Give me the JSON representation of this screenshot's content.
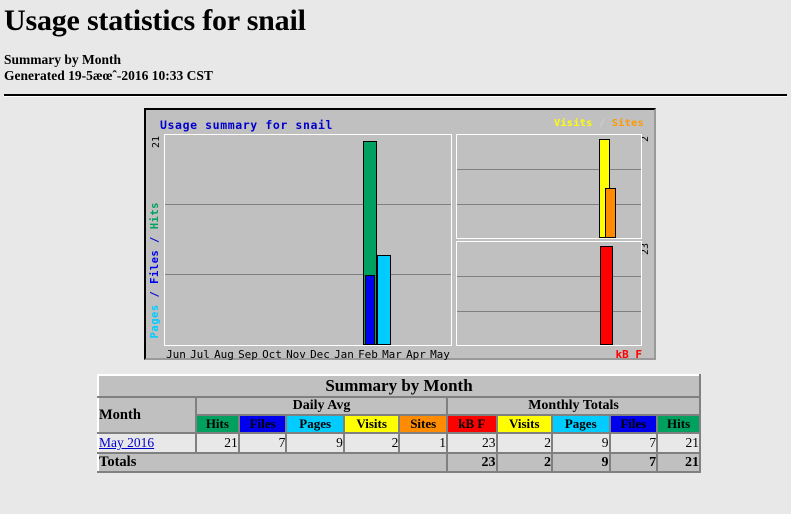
{
  "header": {
    "title": "Usage statistics for snail",
    "summary_line": "Summary by Month",
    "generated_line": "Generated 19-5æœˆ-2016 10:33 CST"
  },
  "chart": {
    "title": "Usage summary for snail",
    "legend_visits": "Visits",
    "legend_separator": " / ",
    "legend_sites": "Sites",
    "left_axis_max": "21",
    "left_axis_label_pages": "Pages",
    "left_axis_label_sep1": " / ",
    "left_axis_label_files": "Files",
    "left_axis_label_sep2": " / ",
    "left_axis_label_hits": "Hits",
    "right_axis_visits_max": "2",
    "right_axis_kb_max": "23",
    "kb_footer": "kB F"
  },
  "chart_data": {
    "type": "bar",
    "title": "Usage summary for snail",
    "categories": [
      "Jun",
      "Jul",
      "Aug",
      "Sep",
      "Oct",
      "Nov",
      "Dec",
      "Jan",
      "Feb",
      "Mar",
      "Apr",
      "May"
    ],
    "panels": [
      {
        "name": "hits-files-pages",
        "ylabel": "Pages / Files / Hits",
        "ylim": [
          0,
          21
        ],
        "grid": true,
        "series": [
          {
            "name": "Hits",
            "color": "#00A060",
            "values": [
              0,
              0,
              0,
              0,
              0,
              0,
              0,
              0,
              0,
              0,
              0,
              21
            ]
          },
          {
            "name": "Files",
            "color": "#0000EE",
            "values": [
              0,
              0,
              0,
              0,
              0,
              0,
              0,
              0,
              0,
              0,
              0,
              7
            ]
          },
          {
            "name": "Pages",
            "color": "#00CCFF",
            "values": [
              0,
              0,
              0,
              0,
              0,
              0,
              0,
              0,
              0,
              0,
              0,
              9
            ]
          }
        ]
      },
      {
        "name": "visits-sites",
        "ylabel": "Visits / Sites",
        "ylim": [
          0,
          2
        ],
        "grid": true,
        "series": [
          {
            "name": "Visits",
            "color": "#FFFF00",
            "values": [
              2
            ]
          },
          {
            "name": "Sites",
            "color": "#FF8C00",
            "values": [
              1
            ]
          }
        ]
      },
      {
        "name": "kbytes",
        "ylabel": "kB F",
        "ylim": [
          0,
          23
        ],
        "grid": true,
        "series": [
          {
            "name": "kB F",
            "color": "#FF0000",
            "values": [
              23
            ]
          }
        ]
      }
    ]
  },
  "table": {
    "caption": "Summary by Month",
    "group_headers": [
      "Daily Avg",
      "Monthly Totals"
    ],
    "month_header": "Month",
    "columns": [
      {
        "label": "Hits",
        "color": "#00A060"
      },
      {
        "label": "Files",
        "color": "#0000EE"
      },
      {
        "label": "Pages",
        "color": "#00CCFF"
      },
      {
        "label": "Visits",
        "color": "#FFFF00"
      },
      {
        "label": "Sites",
        "color": "#FF8C00"
      },
      {
        "label": "kB F",
        "color": "#FF0000"
      },
      {
        "label": "Visits",
        "color": "#FFFF00"
      },
      {
        "label": "Pages",
        "color": "#00CCFF"
      },
      {
        "label": "Files",
        "color": "#0000EE"
      },
      {
        "label": "Hits",
        "color": "#00A060"
      }
    ],
    "rows": [
      {
        "month": "May 2016",
        "values": [
          "21",
          "7",
          "9",
          "2",
          "1",
          "23",
          "2",
          "9",
          "7",
          "21"
        ]
      }
    ],
    "totals": {
      "label": "Totals",
      "values": [
        "23",
        "2",
        "9",
        "7",
        "21"
      ]
    }
  }
}
